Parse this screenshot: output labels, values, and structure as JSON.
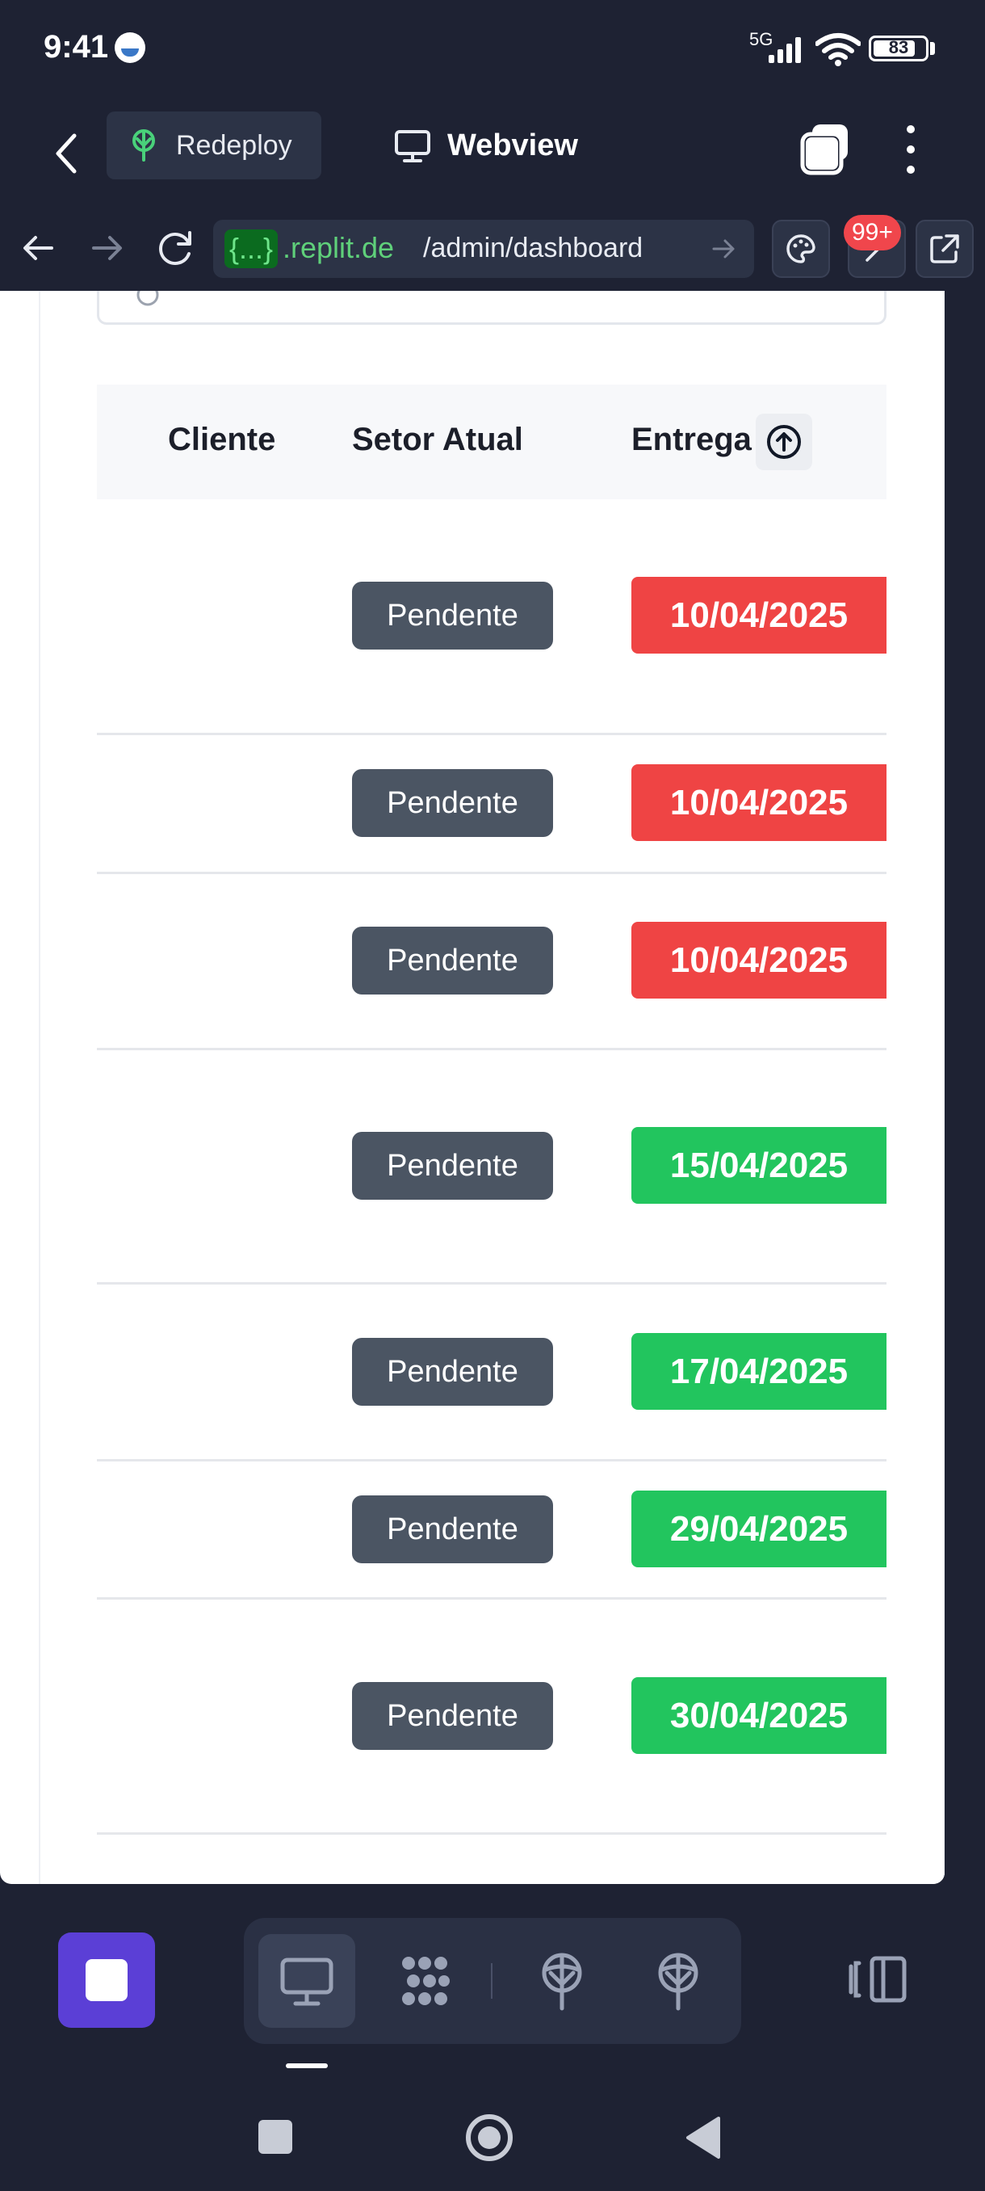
{
  "status_bar": {
    "time": "9:41",
    "network": "5G",
    "battery": "83",
    "battery_level": 0.83
  },
  "header": {
    "back_icon": "chevron-left-icon",
    "redeploy_label": "Redeploy",
    "webview_label": "Webview",
    "tabs_icon": "tabs-icon",
    "more_icon": "kebab-menu-icon"
  },
  "browser": {
    "url_badge": "{...}",
    "url_host": ".replit.de",
    "url_path": "/admin/dashboard",
    "notifications_badge": "99+"
  },
  "table": {
    "columns": [
      "Cliente",
      "Setor Atual",
      "Entrega"
    ],
    "rows": [
      {
        "status": "Pendente",
        "delivery": "10/04/2025",
        "overdue": true
      },
      {
        "status": "Pendente",
        "delivery": "10/04/2025",
        "overdue": true
      },
      {
        "status": "Pendente",
        "delivery": "10/04/2025",
        "overdue": true
      },
      {
        "status": "Pendente",
        "delivery": "15/04/2025",
        "overdue": false
      },
      {
        "status": "Pendente",
        "delivery": "17/04/2025",
        "overdue": false
      },
      {
        "status": "Pendente",
        "delivery": "29/04/2025",
        "overdue": false
      },
      {
        "status": "Pendente",
        "delivery": "30/04/2025",
        "overdue": false
      }
    ]
  },
  "colors": {
    "background": "#1e2233",
    "accent": "#5b3fd6",
    "overdue": "#ef4444",
    "on_time": "#22c55e",
    "status_pill": "#4b5563"
  },
  "bottom_bar": {
    "stop_icon": "stop-square-icon",
    "dock_icons": [
      "monitor-icon",
      "workflow-icon",
      "deploy-icon",
      "deploy-alt-icon"
    ],
    "panel_icon": "panel-toggle-icon"
  },
  "nav_bar": {
    "icons": [
      "recents-square-icon",
      "home-circle-icon",
      "back-triangle-icon"
    ]
  }
}
